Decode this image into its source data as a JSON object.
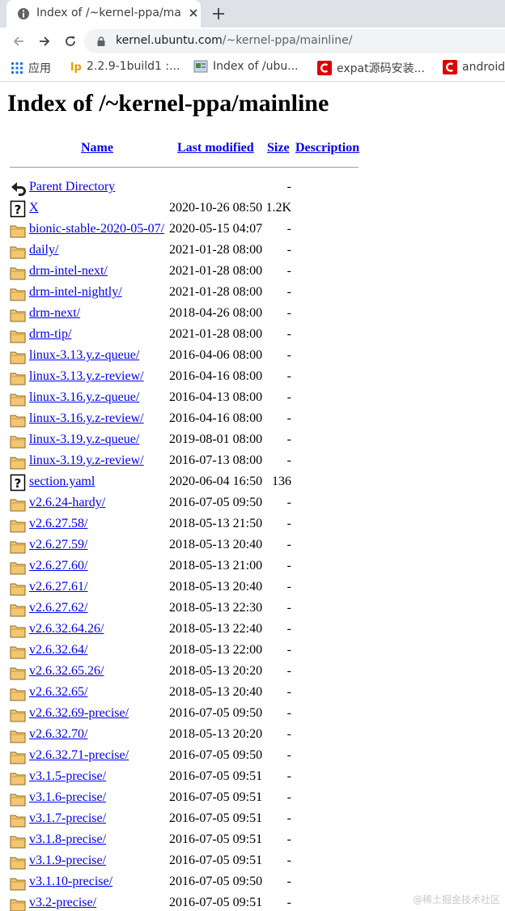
{
  "browser": {
    "tab_title": "Index of /~kernel-ppa/mainline",
    "url_host": "kernel.ubuntu.com",
    "url_path": "/~kernel-ppa/mainline/",
    "bookmarks": [
      {
        "label": "应用",
        "icon": "apps-icon"
      },
      {
        "label": "2.2.9-1build1 :...",
        "icon": "launchpad-icon"
      },
      {
        "label": "Index of /ubu...",
        "icon": "page-icon"
      },
      {
        "label": "expat源码安装...",
        "icon": "csdn-icon"
      },
      {
        "label": "android",
        "icon": "csdn-icon"
      }
    ]
  },
  "page": {
    "title": "Index of /~kernel-ppa/mainline",
    "columns": {
      "name": "Name",
      "modified": "Last modified",
      "size": "Size",
      "description": "Description"
    },
    "rows": [
      {
        "icon": "back",
        "name": "Parent Directory",
        "modified": "",
        "size": "-"
      },
      {
        "icon": "unknown",
        "name": "X",
        "modified": "2020-10-26 08:50",
        "size": "1.2K"
      },
      {
        "icon": "folder",
        "name": "bionic-stable-2020-05-07/",
        "modified": "2020-05-15 04:07",
        "size": "-"
      },
      {
        "icon": "folder",
        "name": "daily/",
        "modified": "2021-01-28 08:00",
        "size": "-"
      },
      {
        "icon": "folder",
        "name": "drm-intel-next/",
        "modified": "2021-01-28 08:00",
        "size": "-"
      },
      {
        "icon": "folder",
        "name": "drm-intel-nightly/",
        "modified": "2021-01-28 08:00",
        "size": "-"
      },
      {
        "icon": "folder",
        "name": "drm-next/",
        "modified": "2018-04-26 08:00",
        "size": "-"
      },
      {
        "icon": "folder",
        "name": "drm-tip/",
        "modified": "2021-01-28 08:00",
        "size": "-"
      },
      {
        "icon": "folder",
        "name": "linux-3.13.y.z-queue/",
        "modified": "2016-04-06 08:00",
        "size": "-"
      },
      {
        "icon": "folder",
        "name": "linux-3.13.y.z-review/",
        "modified": "2016-04-16 08:00",
        "size": "-"
      },
      {
        "icon": "folder",
        "name": "linux-3.16.y.z-queue/",
        "modified": "2016-04-13 08:00",
        "size": "-"
      },
      {
        "icon": "folder",
        "name": "linux-3.16.y.z-review/",
        "modified": "2016-04-16 08:00",
        "size": "-"
      },
      {
        "icon": "folder",
        "name": "linux-3.19.y.z-queue/",
        "modified": "2019-08-01 08:00",
        "size": "-"
      },
      {
        "icon": "folder",
        "name": "linux-3.19.y.z-review/",
        "modified": "2016-07-13 08:00",
        "size": "-"
      },
      {
        "icon": "unknown",
        "name": "section.yaml",
        "modified": "2020-06-04 16:50",
        "size": "136"
      },
      {
        "icon": "folder",
        "name": "v2.6.24-hardy/",
        "modified": "2016-07-05 09:50",
        "size": "-"
      },
      {
        "icon": "folder",
        "name": "v2.6.27.58/",
        "modified": "2018-05-13 21:50",
        "size": "-"
      },
      {
        "icon": "folder",
        "name": "v2.6.27.59/",
        "modified": "2018-05-13 20:40",
        "size": "-"
      },
      {
        "icon": "folder",
        "name": "v2.6.27.60/",
        "modified": "2018-05-13 21:00",
        "size": "-"
      },
      {
        "icon": "folder",
        "name": "v2.6.27.61/",
        "modified": "2018-05-13 20:40",
        "size": "-"
      },
      {
        "icon": "folder",
        "name": "v2.6.27.62/",
        "modified": "2018-05-13 22:30",
        "size": "-"
      },
      {
        "icon": "folder",
        "name": "v2.6.32.64.26/",
        "modified": "2018-05-13 22:40",
        "size": "-"
      },
      {
        "icon": "folder",
        "name": "v2.6.32.64/",
        "modified": "2018-05-13 22:00",
        "size": "-"
      },
      {
        "icon": "folder",
        "name": "v2.6.32.65.26/",
        "modified": "2018-05-13 20:20",
        "size": "-"
      },
      {
        "icon": "folder",
        "name": "v2.6.32.65/",
        "modified": "2018-05-13 20:40",
        "size": "-"
      },
      {
        "icon": "folder",
        "name": "v2.6.32.69-precise/",
        "modified": "2016-07-05 09:50",
        "size": "-"
      },
      {
        "icon": "folder",
        "name": "v2.6.32.70/",
        "modified": "2018-05-13 20:20",
        "size": "-"
      },
      {
        "icon": "folder",
        "name": "v2.6.32.71-precise/",
        "modified": "2016-07-05 09:50",
        "size": "-"
      },
      {
        "icon": "folder",
        "name": "v3.1.5-precise/",
        "modified": "2016-07-05 09:51",
        "size": "-"
      },
      {
        "icon": "folder",
        "name": "v3.1.6-precise/",
        "modified": "2016-07-05 09:51",
        "size": "-"
      },
      {
        "icon": "folder",
        "name": "v3.1.7-precise/",
        "modified": "2016-07-05 09:51",
        "size": "-"
      },
      {
        "icon": "folder",
        "name": "v3.1.8-precise/",
        "modified": "2016-07-05 09:51",
        "size": "-"
      },
      {
        "icon": "folder",
        "name": "v3.1.9-precise/",
        "modified": "2016-07-05 09:51",
        "size": "-"
      },
      {
        "icon": "folder",
        "name": "v3.1.10-precise/",
        "modified": "2016-07-05 09:50",
        "size": "-"
      },
      {
        "icon": "folder",
        "name": "v3.2-precise/",
        "modified": "2016-07-05 09:51",
        "size": "-"
      }
    ]
  },
  "watermark": "@稀土掘金技术社区"
}
